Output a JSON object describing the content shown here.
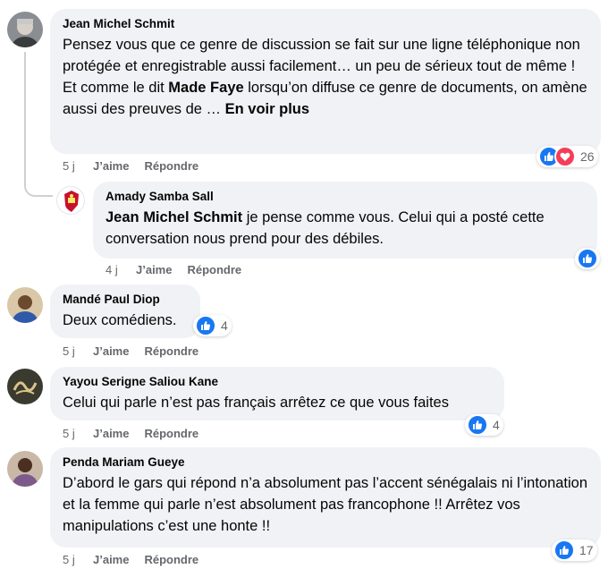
{
  "comments": [
    {
      "author": "Jean Michel Schmit",
      "text_parts": [
        "Pensez vous que ce genre de discussion se fait sur une ligne téléphonique non protégée et enregistrable aussi facilement… un peu de sérieux tout de même ! Et comme le dit ",
        "Made Faye",
        " lorsqu’on diffuse ce genre de documents, on amène aussi des preuves de … ",
        "En voir plus"
      ],
      "time": "5 j",
      "like_label": "J’aime",
      "reply_label": "Répondre",
      "reaction_count": "26"
    },
    {
      "author": "Amady Samba Sall",
      "mention": "Jean Michel Schmit",
      "text": " je pense comme vous. Celui qui a posté cette conversation nous prend pour des débiles.",
      "time": "4 j",
      "like_label": "J’aime",
      "reply_label": "Répondre",
      "reaction_count": ""
    },
    {
      "author": "Mandé Paul Diop",
      "text": "Deux comédiens.",
      "time": "5 j",
      "like_label": "J’aime",
      "reply_label": "Répondre",
      "reaction_count": "4"
    },
    {
      "author": "Yayou Serigne Saliou Kane",
      "text": "Celui qui parle n’est pas français arrêtez ce que vous faites",
      "time": "5 j",
      "like_label": "J’aime",
      "reply_label": "Répondre",
      "reaction_count": "4"
    },
    {
      "author": "Penda Mariam Gueye",
      "text": "D’abord le gars qui répond n’a absolument pas l’accent sénégalais ni l’intonation et la femme qui parle n’est absolument pas francophone !! Arrêtez vos manipulations c’est une honte !!",
      "time": "5 j",
      "like_label": "J’aime",
      "reply_label": "Répondre",
      "reaction_count": "17"
    }
  ],
  "colors": {
    "bubble": "#f0f2f5",
    "like_blue": "#1877f2",
    "love_red": "#f33e58",
    "meta_gray": "#65676b"
  }
}
